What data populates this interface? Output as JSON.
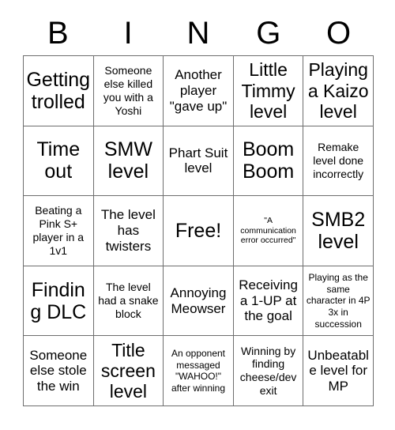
{
  "header": {
    "letters": [
      "B",
      "I",
      "N",
      "G",
      "O"
    ]
  },
  "grid": {
    "rows": 5,
    "columns": 5,
    "border_color": "#6e6e6e",
    "background_color": "#ffffff",
    "text_color": "#000000"
  },
  "cells": [
    {
      "text": "Getting trolled",
      "size": "xl"
    },
    {
      "text": "Someone else killed you with a Yoshi",
      "size": "sm"
    },
    {
      "text": "Another player \"gave up\"",
      "size": "md"
    },
    {
      "text": "Little Timmy level",
      "size": "lg"
    },
    {
      "text": "Playing a Kaizo level",
      "size": "lg"
    },
    {
      "text": "Time out",
      "size": "xl"
    },
    {
      "text": "SMW level",
      "size": "xl"
    },
    {
      "text": "Phart Suit level",
      "size": "md"
    },
    {
      "text": "Boom Boom",
      "size": "xl"
    },
    {
      "text": "Remake level done incorrectly",
      "size": "sm"
    },
    {
      "text": "Beating a Pink S+ player in a 1v1",
      "size": "sm"
    },
    {
      "text": "The level has twisters",
      "size": "md"
    },
    {
      "text": "Free!",
      "size": "xl"
    },
    {
      "text": "\"A communication error occurred\"",
      "size": "xxs"
    },
    {
      "text": "SMB2 level",
      "size": "xl"
    },
    {
      "text": "Finding DLC",
      "size": "xl"
    },
    {
      "text": "The level had a snake block",
      "size": "sm"
    },
    {
      "text": "Annoying Meowser",
      "size": "md"
    },
    {
      "text": "Receiving a 1-UP at the goal",
      "size": "md"
    },
    {
      "text": "Playing as the same character in 4P 3x in succession",
      "size": "xs"
    },
    {
      "text": "Someone else stole the win",
      "size": "md"
    },
    {
      "text": "Title screen level",
      "size": "lg"
    },
    {
      "text": "An opponent messaged \"WAHOO!\" after winning",
      "size": "xs"
    },
    {
      "text": "Winning by finding cheese/dev exit",
      "size": "sm"
    },
    {
      "text": "Unbeatable level for MP",
      "size": "md"
    }
  ]
}
